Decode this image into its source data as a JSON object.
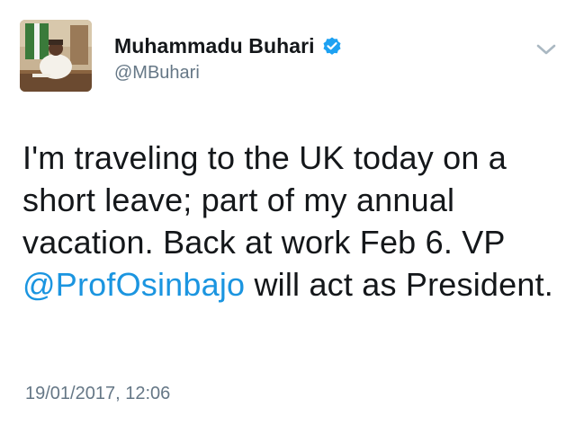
{
  "tweet": {
    "author": {
      "display_name": "Muhammadu Buhari",
      "handle": "@MBuhari",
      "verified": true,
      "avatar_icon": "profile-photo"
    },
    "text_before": "I'm traveling to the UK today on a short leave; part of my annual vacation. Back at work Feb 6. VP ",
    "mention": "@ProfOsinbajo",
    "text_after": " will act as President.",
    "timestamp": "19/01/2017, 12:06",
    "menu_icon": "chevron-down-icon"
  },
  "colors": {
    "text": "#14171a",
    "secondary": "#657786",
    "link": "#1b95e0",
    "verified_badge": "#1da1f2",
    "chevron": "#aab8c2"
  }
}
